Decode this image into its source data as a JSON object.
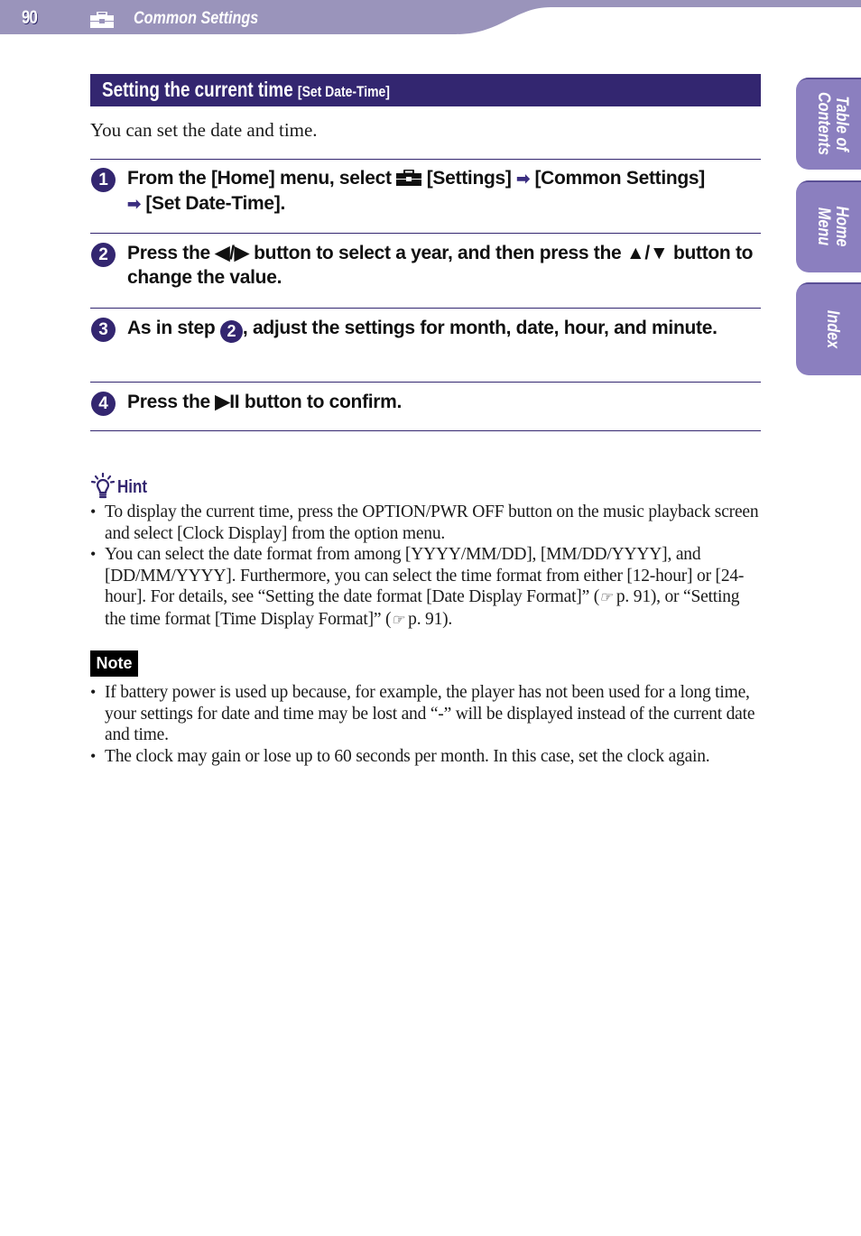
{
  "header": {
    "page_number": "90",
    "section_icon": "toolbox-icon",
    "section_title": "Common Settings",
    "band_color": "#9a94bb"
  },
  "title": {
    "main": "Setting the current time",
    "sub": "[Set Date-Time]",
    "bar_color": "#332670"
  },
  "intro": "You can set the date and time.",
  "steps": [
    {
      "number": "1",
      "parts": {
        "a": "From the [Home] menu, select ",
        "icon": "toolbox-icon",
        "b": " [Settings] ",
        "arrow1": "➡",
        "c": " [Common Settings] ",
        "arrow2": "➡",
        "d": " [Set Date-Time]."
      }
    },
    {
      "number": "2",
      "parts": {
        "a": "Press the ",
        "lr": "◀/▶",
        "b": " button to select a year, and then press the ",
        "ud": "▲/▼",
        "c": " button to change the value."
      }
    },
    {
      "number": "3",
      "parts": {
        "a": "As in step ",
        "ref": "2",
        "b": ", adjust the settings for month, date, hour, and minute."
      }
    },
    {
      "number": "4",
      "parts": {
        "a": "Press the ",
        "play": "▶II",
        "b": " button to confirm."
      }
    }
  ],
  "hint": {
    "icon": "lightbulb-icon",
    "label": "Hint",
    "items": [
      {
        "text": "To display the current time, press the OPTION/PWR OFF button on the music playback screen and select [Clock Display] from the option menu."
      },
      {
        "a": "You can select the date format from among [YYYY/MM/DD], [MM/DD/YYYY], and [DD/MM/YYYY]. Furthermore, you can select the time format from either [12-hour] or [24-hour]. For details, see “Setting the date format [Date Display Format]” (",
        "ref1_icon": "☞",
        "ref1": " p. 91), or “Setting the time format [Time Display Format]” (",
        "ref2_icon": "☞",
        "ref2": " p. 91)."
      }
    ]
  },
  "note": {
    "label": "Note",
    "items": [
      "If battery power is used up because, for example, the player has not been used for a long time, your settings for date and time may be lost and “-” will be displayed instead of the current date and time.",
      "The clock may gain or lose up to 60 seconds per month. In this case, set the clock again."
    ]
  },
  "side_tabs": [
    {
      "label": "Table of\nContents"
    },
    {
      "label": "Home\nMenu"
    },
    {
      "label": "Index"
    }
  ]
}
